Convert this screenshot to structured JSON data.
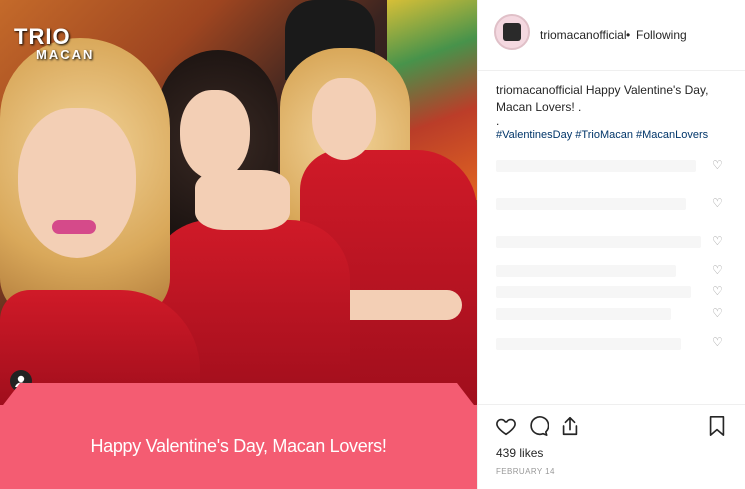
{
  "photo": {
    "logo_line1": "TRIO",
    "logo_line2": "MACAN",
    "banner_text": "Happy Valentine's Day, Macan Lovers!"
  },
  "header": {
    "username": "triomacanofficial",
    "separator": "•",
    "follow_status": "Following"
  },
  "caption": {
    "username": "triomacanofficial",
    "text": "Happy Valentine's Day, Macan Lovers! .",
    "dot": ".",
    "hashtags": "#ValentinesDay #TrioMacan #MacanLovers"
  },
  "actions": {
    "likes": "439 likes",
    "date": "FEBRUARY 14"
  },
  "icons": [
    "heart-icon",
    "comment-icon",
    "share-icon",
    "bookmark-icon",
    "user-tag-icon"
  ]
}
